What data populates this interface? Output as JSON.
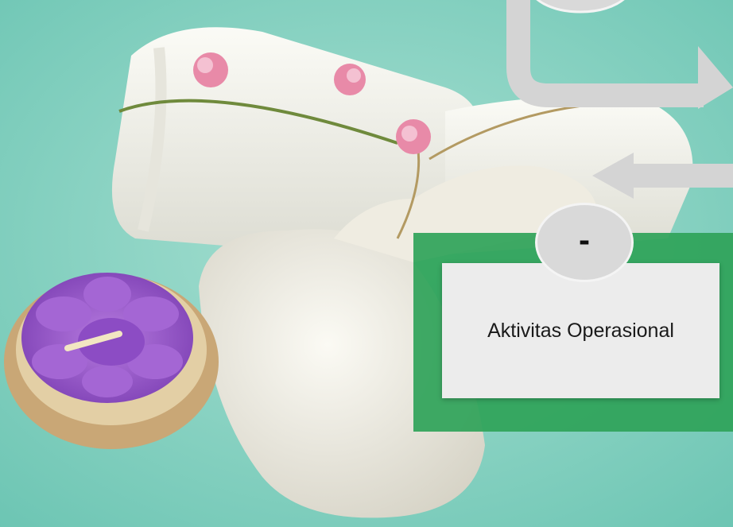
{
  "diagram": {
    "node_label": "Aktivitas Operasional",
    "connector_symbol": "-",
    "colors": {
      "panel_green": "#2fa359",
      "card_gray": "#ececec",
      "arrow_gray": "#d4d4d4"
    }
  },
  "background": {
    "description_icon": "spa-photo"
  }
}
